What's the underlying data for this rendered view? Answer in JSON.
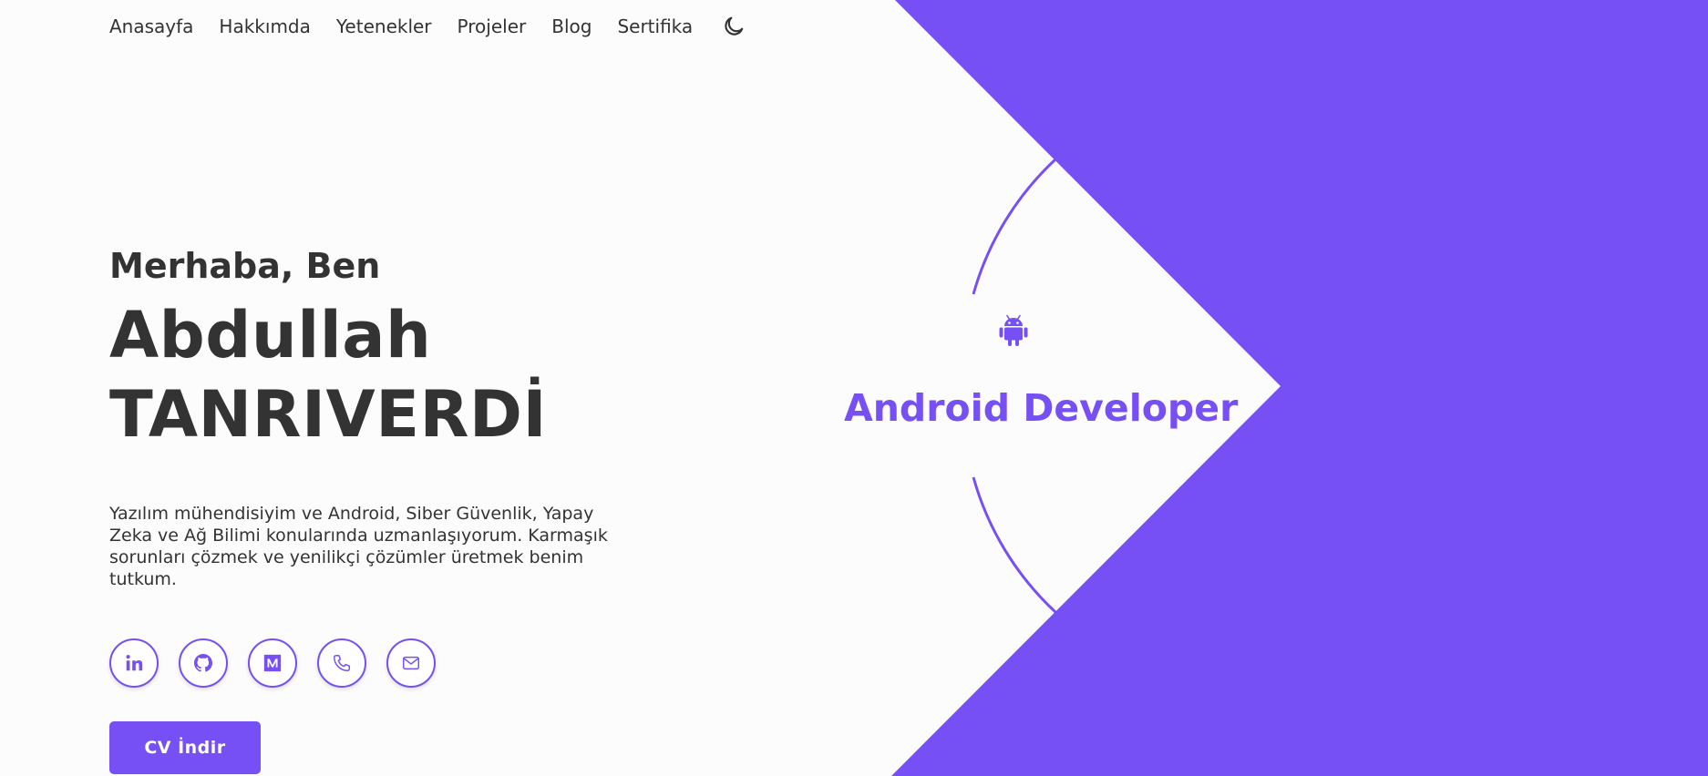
{
  "nav": {
    "items": [
      {
        "label": "Anasayfa"
      },
      {
        "label": "Hakkımda"
      },
      {
        "label": "Yetenekler"
      },
      {
        "label": "Projeler"
      },
      {
        "label": "Blog"
      },
      {
        "label": "Sertifika"
      }
    ],
    "theme_toggle_icon": "moon-icon"
  },
  "hero": {
    "greeting": "Merhaba, Ben",
    "name_first": "Abdullah",
    "name_last": "TANRIVERDİ",
    "description": "Yazılım mühendisiyim ve Android, Siber Güvenlik, Yapay Zeka ve Ağ Bilimi konularında uzmanlaşıyorum. Karmaşık sorunları çözmek ve yenilikçi çözümler üretmek benim tutkum.",
    "cv_button": "CV İndir"
  },
  "socials": [
    {
      "icon": "linkedin-icon"
    },
    {
      "icon": "github-icon"
    },
    {
      "icon": "medium-icon"
    },
    {
      "icon": "phone-icon"
    },
    {
      "icon": "mail-icon"
    }
  ],
  "role": {
    "icon": "android-icon",
    "title": "Android Developer"
  },
  "colors": {
    "accent": "#7650f5",
    "text": "#333333",
    "background": "#fdfcfd"
  }
}
